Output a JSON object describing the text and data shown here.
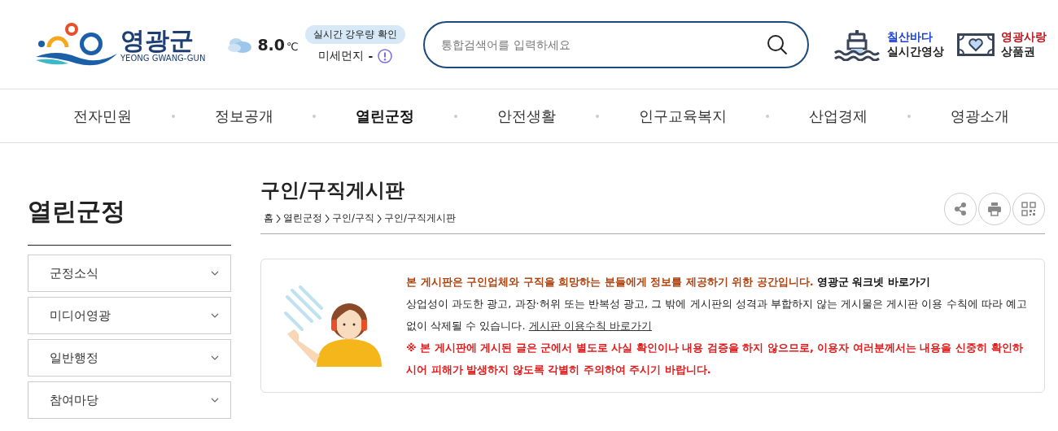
{
  "header": {
    "logo": {
      "name": "영광군",
      "subtitle": "YEONG GWANG-GUN"
    },
    "weather": {
      "temperature": "8.0",
      "unit": "℃",
      "rain_button": "실시간 강우량 확인",
      "dust_label": "미세먼지",
      "dust_value": "-"
    },
    "search": {
      "placeholder": "통합검색어를 입력하세요"
    },
    "quick_links": [
      {
        "kind": "buoy",
        "top": "칠산바다",
        "bottom": "실시간영상",
        "color": "#1a3fd6"
      },
      {
        "kind": "voucher",
        "top": "영광사랑",
        "bottom": "상품권",
        "color": "#c0151b"
      }
    ]
  },
  "nav": [
    {
      "label": "전자민원",
      "selected": false
    },
    {
      "label": "정보공개",
      "selected": false
    },
    {
      "label": "열린군정",
      "selected": true
    },
    {
      "label": "안전생활",
      "selected": false
    },
    {
      "label": "인구교육복지",
      "selected": false
    },
    {
      "label": "산업경제",
      "selected": false
    },
    {
      "label": "영광소개",
      "selected": false
    }
  ],
  "sidebar": {
    "title": "열린군정",
    "items": [
      {
        "label": "군정소식",
        "expanded": false
      },
      {
        "label": "미디어영광",
        "expanded": false
      },
      {
        "label": "일반행정",
        "expanded": false
      },
      {
        "label": "참여마당",
        "expanded": false
      }
    ]
  },
  "main": {
    "title": "구인/구직게시판",
    "breadcrumb": [
      "홈",
      "열린군정",
      "구인/구직",
      "구인/구직게시판"
    ],
    "tools": [
      {
        "kind": "share"
      },
      {
        "kind": "print"
      },
      {
        "kind": "qr"
      }
    ],
    "notice": {
      "intro": "본 게시판은 구인업체와 구직을 희망하는 분들에게 정보를 제공하기 위한 공간입니다.",
      "intro_link": "영광군 워크넷 바로가기",
      "body": "상업성이 과도한 광고, 과장·허위 또는 반복성 광고, 그 밖에 게시판의 성격과 부합하지 않는 게시물은 게시판 이용 수칙에 따라 예고 없이 삭제될 수 있습니다.",
      "body_link": "게시판 이용수칙 바로가기",
      "warning": "※ 본 게시판에 게시된 글은 군에서 별도로 사실 확인이나 내용 검증을 하지 않으므로, 이용자 여러분께서는 내용을 신중히 확인하시어 피해가 발생하지 않도록 각별히 주의하여 주시기 바랍니다."
    }
  }
}
